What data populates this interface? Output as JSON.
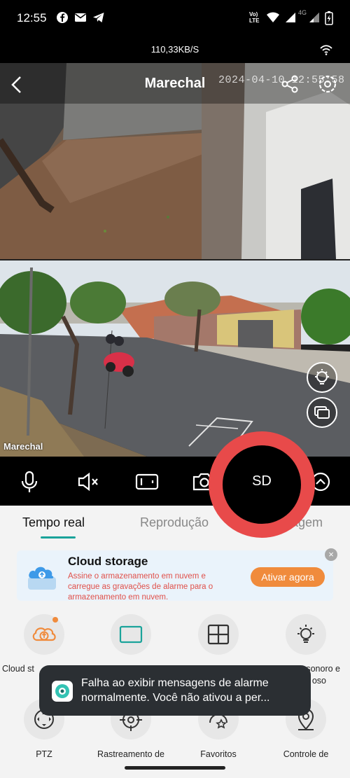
{
  "status_bar": {
    "time": "12:55",
    "icons": [
      "facebook-icon",
      "mail-icon",
      "telegram-icon",
      "volte-icon",
      "wifi-icon",
      "signal-icon",
      "signal-4g-icon",
      "battery-charging-icon"
    ],
    "network_label": "Vo) LTE",
    "net_4g": "4G"
  },
  "speed_bar": {
    "speed": "110,33KB/S"
  },
  "video": {
    "title": "Marechal",
    "timestamp": "2024-04-10 12:55:58",
    "camera_label": "Marechal"
  },
  "controls": {
    "items": [
      "microphone-icon",
      "mute-icon",
      "record-icon",
      "camera-icon",
      "sd-icon",
      "chevron-up-icon"
    ]
  },
  "tabs": [
    {
      "label": "Tempo real",
      "active": true
    },
    {
      "label": "Reprodução",
      "active": false
    },
    {
      "label": "agem",
      "active": false
    }
  ],
  "banner": {
    "title": "Cloud storage",
    "description": "Assine o armazenamento em nuvem e carregue as gravações de alarme para o armazenamento em nuvem.",
    "button": "Ativar agora"
  },
  "grid": [
    {
      "label": "Cloud st",
      "icon": "cloud-upload-icon"
    },
    {
      "label": "",
      "icon": "single-view-icon"
    },
    {
      "label": "",
      "icon": "four-view-icon"
    },
    {
      "label": "sonoro e",
      "label2": "oso",
      "icon": "light-icon"
    },
    {
      "label": "PTZ",
      "icon": "ptz-icon"
    },
    {
      "label": "Rastreamento de",
      "icon": "tracking-icon"
    },
    {
      "label": "Favoritos",
      "icon": "favorites-icon"
    },
    {
      "label": "Controle de",
      "icon": "location-control-icon"
    }
  ],
  "toast": {
    "message": "Falha ao exibir mensagens de alarme normalmente. Você não ativou a per..."
  },
  "overlay": {
    "sd_label": "SD",
    "ring_color": "#e84a4a"
  },
  "colors": {
    "accent": "#1aa39a",
    "orange": "#f08b3c",
    "error": "#e0504a"
  }
}
